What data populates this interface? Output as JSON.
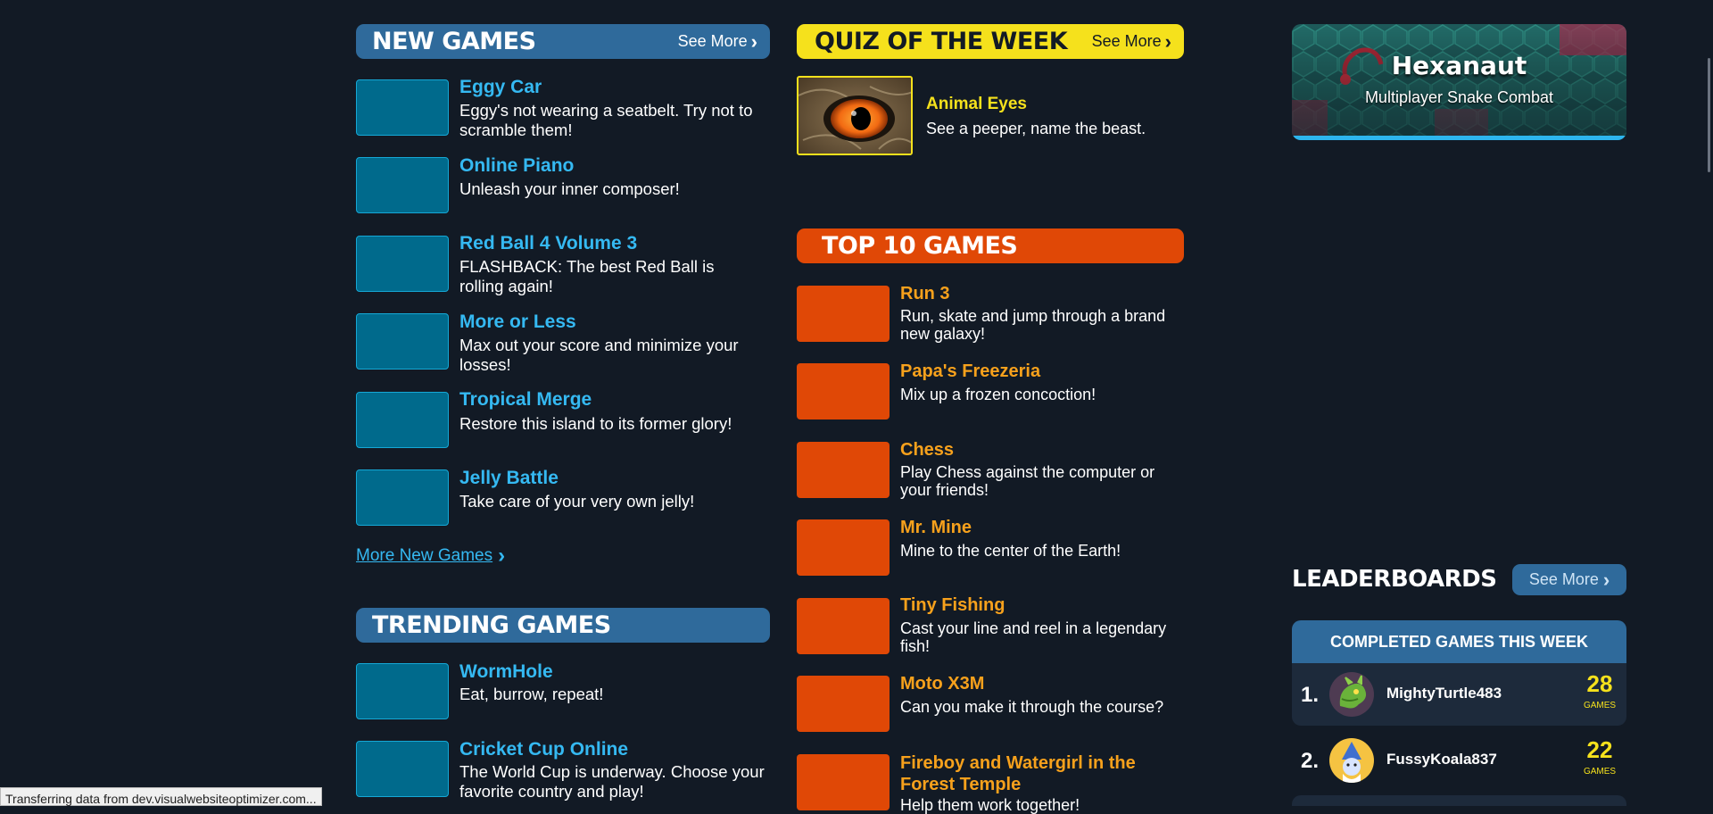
{
  "new_games": {
    "title": "NEW GAMES",
    "see_more": "See More",
    "items": [
      {
        "title": "Eggy Car",
        "desc": "Eggy's not wearing a seatbelt. Try not to scramble them!"
      },
      {
        "title": "Online Piano",
        "desc": "Unleash your inner composer!"
      },
      {
        "title": "Red Ball 4 Volume 3",
        "desc": "FLASHBACK: The best Red Ball is rolling again!"
      },
      {
        "title": "More or Less",
        "desc": "Max out your score and minimize your losses!"
      },
      {
        "title": "Tropical Merge",
        "desc": "Restore this island to its former glory!"
      },
      {
        "title": "Jelly Battle",
        "desc": "Take care of your very own jelly!"
      }
    ],
    "more_link": "More New Games"
  },
  "trending_games": {
    "title": "TRENDING GAMES",
    "items": [
      {
        "title": "WormHole",
        "desc": "Eat, burrow, repeat!"
      },
      {
        "title": "Cricket Cup Online",
        "desc": "The World Cup is underway. Choose your favorite country and play!"
      }
    ]
  },
  "quiz": {
    "title": "QUIZ OF THE WEEK",
    "see_more": "See More",
    "item_title": "Animal Eyes",
    "item_desc": "See a peeper, name the beast."
  },
  "top10": {
    "title": "TOP 10 GAMES",
    "items": [
      {
        "title": "Run 3",
        "desc": "Run, skate and jump through a brand new galaxy!"
      },
      {
        "title": "Papa's Freezeria",
        "desc": "Mix up a frozen concoction!"
      },
      {
        "title": "Chess",
        "desc": "Play Chess against the computer or your friends!"
      },
      {
        "title": "Mr. Mine",
        "desc": "Mine to the center of the Earth!"
      },
      {
        "title": "Tiny Fishing",
        "desc": "Cast your line and reel in a legendary fish!"
      },
      {
        "title": "Moto X3M",
        "desc": "Can you make it through the course?"
      },
      {
        "title": "Fireboy and Watergirl in the Forest Temple",
        "desc": "Help them work together!"
      }
    ]
  },
  "feature": {
    "title": "Hexanaut",
    "subtitle": "Multiplayer Snake Combat"
  },
  "leaderboards": {
    "title": "LEADERBOARDS",
    "see_more": "See More",
    "board_title": "COMPLETED GAMES THIS WEEK",
    "rows": [
      {
        "rank": "1.",
        "name": "MightyTurtle483",
        "count": "28",
        "unit": "GAMES"
      },
      {
        "rank": "2.",
        "name": "FussyKoala837",
        "count": "22",
        "unit": "GAMES"
      }
    ]
  },
  "status_bar": "Transferring data from dev.visualwebsiteoptimizer.com...",
  "colors": {
    "background": "#121a25",
    "blue_header": "#2f6a9b",
    "quiz_yellow": "#f5e11c",
    "top10_orange": "#e04806",
    "title_blue": "#35b9f2",
    "title_orange": "#f7a11c"
  }
}
